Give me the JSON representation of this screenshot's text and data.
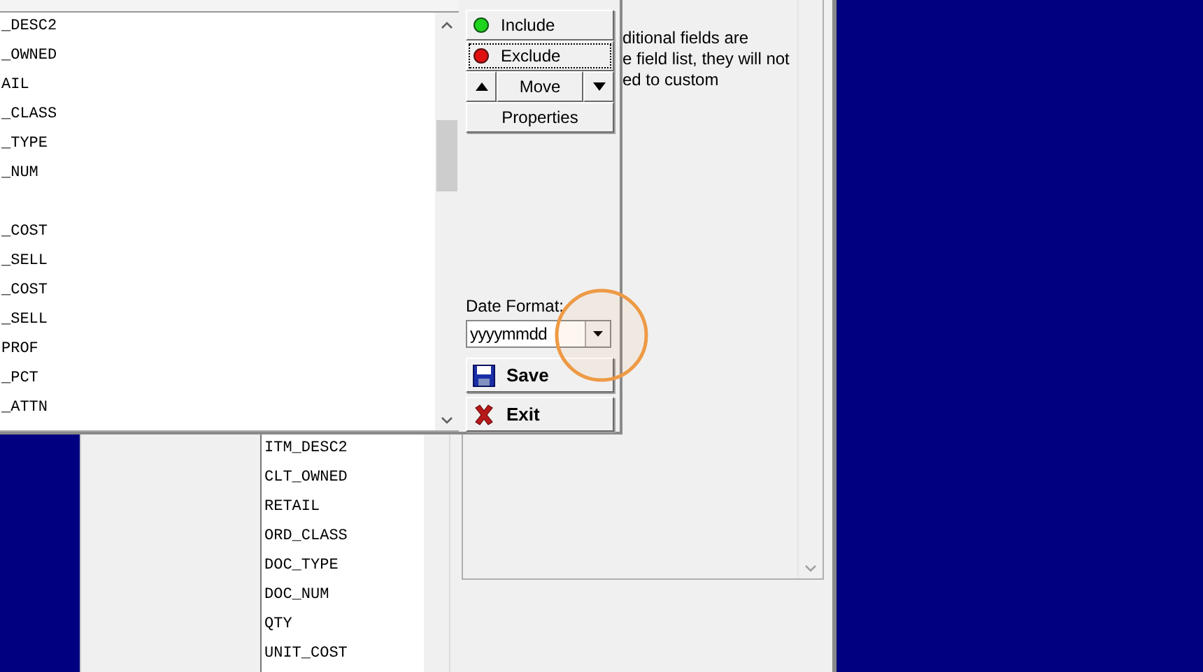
{
  "dialog": {
    "field_list": {
      "rows": [
        {
          "kind": "text",
          "label": "_DESC2"
        },
        {
          "kind": "text",
          "label": "_OWNED"
        },
        {
          "kind": "text",
          "label": "AIL"
        },
        {
          "kind": "text",
          "label": "_CLASS"
        },
        {
          "kind": "text",
          "label": "_TYPE"
        },
        {
          "kind": "text",
          "label": "_NUM"
        },
        {
          "kind": "hidden"
        },
        {
          "kind": "text",
          "label": "_COST"
        },
        {
          "kind": "text",
          "label": "_SELL"
        },
        {
          "kind": "text",
          "label": "_COST"
        },
        {
          "kind": "text",
          "label": "_SELL"
        },
        {
          "kind": "text",
          "label": "PROF"
        },
        {
          "kind": "text",
          "label": "_PCT"
        },
        {
          "kind": "text",
          "label": "_ATTN"
        }
      ]
    },
    "buttons": [
      {
        "kind": "include",
        "label": "Include",
        "focused": false
      },
      {
        "kind": "exclude",
        "label": "Exclude",
        "focused": true
      }
    ],
    "move": {
      "label": "Move"
    },
    "properties": {
      "label": "Properties"
    },
    "date_format": {
      "label": "Date Format:",
      "value": "yyyymmdd"
    },
    "actions": [
      {
        "kind": "save",
        "label": "Save"
      },
      {
        "kind": "exit",
        "label": "Exit"
      }
    ]
  },
  "background_window": {
    "help_lines": [
      "ditional fields are",
      "e field list, they will not",
      "ed to custom"
    ],
    "field_list": [
      "ITM_DESC2",
      "CLT_OWNED",
      "RETAIL",
      "ORD_CLASS",
      "DOC_TYPE",
      "DOC_NUM",
      "QTY",
      "UNIT_COST"
    ]
  }
}
